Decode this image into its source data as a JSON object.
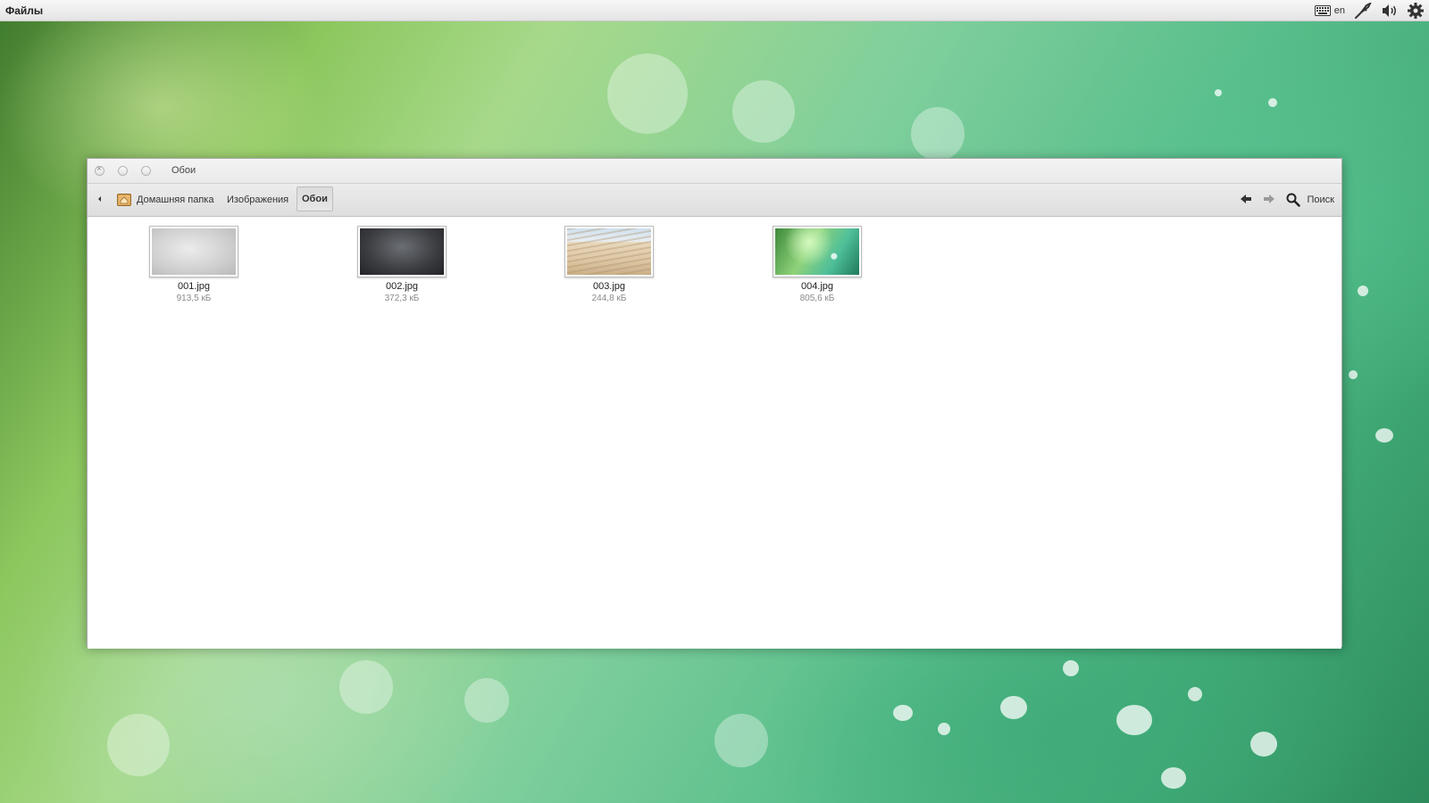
{
  "panel": {
    "app_menu": "Файлы",
    "keyboard_layout": "en",
    "tray_icons": [
      "keyboard-icon",
      "network-icon",
      "volume-icon",
      "gear-icon"
    ]
  },
  "window": {
    "title": "Обои",
    "breadcrumbs": [
      {
        "label": "Домашняя папка",
        "icon": "home-folder-icon"
      },
      {
        "label": "Изображения"
      },
      {
        "label": "Обои",
        "current": true
      }
    ],
    "search_label": "Поиск",
    "files": [
      {
        "name": "001.jpg",
        "size": "913,5 кБ",
        "thumb": "light-gray-blur"
      },
      {
        "name": "002.jpg",
        "size": "372,3 кБ",
        "thumb": "dark-gray-gradient"
      },
      {
        "name": "003.jpg",
        "size": "244,8 кБ",
        "thumb": "sand-dunes"
      },
      {
        "name": "004.jpg",
        "size": "805,6 кБ",
        "thumb": "green-leaf-drops"
      }
    ]
  },
  "colors": {
    "panel_bg": "#e9e9e9",
    "window_bg": "#ffffff",
    "toolbar_bg": "#e4e4e4",
    "desktop_green": "#7fcf9c"
  }
}
